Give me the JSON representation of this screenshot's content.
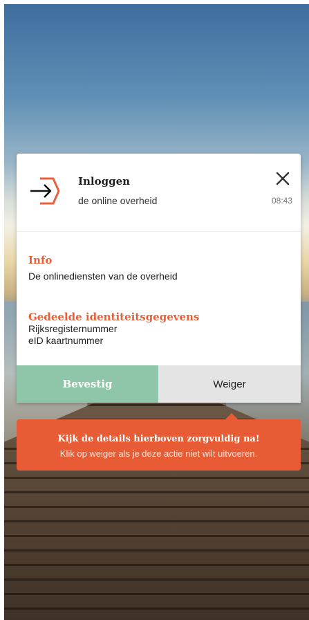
{
  "request": {
    "title": "Inloggen",
    "subtitle": "de online overheid",
    "time": "08:43",
    "icon": "arrow-right-login-icon",
    "close_icon": "close-icon"
  },
  "info": {
    "heading": "Info",
    "text": "De onlinediensten van de overheid"
  },
  "shared": {
    "heading": "Gedeelde identiteitsgegevens",
    "items": [
      "Rijksregisternummer",
      "eID kaartnummer"
    ]
  },
  "actions": {
    "confirm_label": "Bevestig",
    "reject_label": "Weiger"
  },
  "warning": {
    "title": "Kijk de details hierboven zorgvuldig na!",
    "text": "Klik op weiger als je deze actie niet wilt uitvoeren."
  },
  "colors": {
    "accent": "#e8603a",
    "confirm": "#8fc5a9",
    "reject": "#e4e4e4",
    "warning": "#e85c35"
  }
}
